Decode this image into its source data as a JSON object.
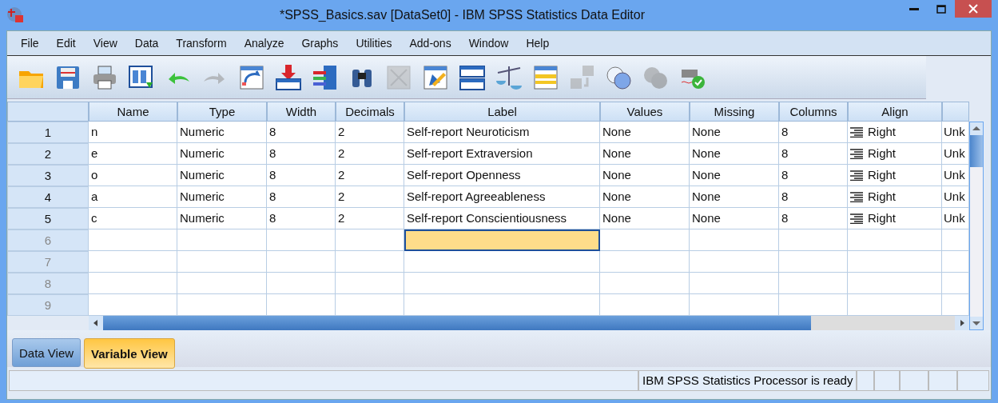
{
  "window": {
    "title": "*SPSS_Basics.sav [DataSet0] - IBM SPSS Statistics Data Editor"
  },
  "menu": [
    "File",
    "Edit",
    "View",
    "Data",
    "Transform",
    "Analyze",
    "Graphs",
    "Utilities",
    "Add-ons",
    "Window",
    "Help"
  ],
  "toolbar": [
    {
      "disabled": false
    },
    {
      "disabled": false
    },
    {
      "disabled": false
    },
    {
      "disabled": false
    },
    {
      "disabled": false
    },
    {
      "disabled": true
    },
    {
      "disabled": false
    },
    {
      "disabled": false
    },
    {
      "disabled": false
    },
    {
      "disabled": false
    },
    {
      "disabled": true
    },
    {
      "disabled": false
    },
    {
      "disabled": false
    },
    {
      "disabled": false
    },
    {
      "disabled": false
    },
    {
      "disabled": true
    },
    {
      "disabled": false
    },
    {
      "disabled": true
    },
    {
      "disabled": false
    }
  ],
  "table": {
    "columns": [
      {
        "label": "Name",
        "kind": "text"
      },
      {
        "label": "Type",
        "kind": "text"
      },
      {
        "label": "Width",
        "kind": "text"
      },
      {
        "label": "Decimals",
        "kind": "text"
      },
      {
        "label": "Label",
        "kind": "text"
      },
      {
        "label": "Values",
        "kind": "text"
      },
      {
        "label": "Missing",
        "kind": "text"
      },
      {
        "label": "Columns",
        "kind": "text"
      },
      {
        "label": "Align",
        "kind": "align"
      },
      {
        "kind": "text"
      }
    ],
    "rows": [
      {
        "number": "1",
        "cells": [
          {
            "text": "n",
            "selected": false
          },
          {
            "text": "Numeric",
            "selected": false
          },
          {
            "text": "8",
            "selected": false
          },
          {
            "text": "2",
            "selected": false
          },
          {
            "text": "Self-report Neuroticism",
            "selected": false
          },
          {
            "text": "None",
            "selected": false
          },
          {
            "text": "None",
            "selected": false
          },
          {
            "text": "8",
            "selected": false
          },
          {
            "text": "Right",
            "selected": false
          },
          {
            "text": "Unk",
            "selected": false
          }
        ]
      },
      {
        "number": "2",
        "cells": [
          {
            "text": "e",
            "selected": false
          },
          {
            "text": "Numeric",
            "selected": false
          },
          {
            "text": "8",
            "selected": false
          },
          {
            "text": "2",
            "selected": false
          },
          {
            "text": "Self-report Extraversion",
            "selected": false
          },
          {
            "text": "None",
            "selected": false
          },
          {
            "text": "None",
            "selected": false
          },
          {
            "text": "8",
            "selected": false
          },
          {
            "text": "Right",
            "selected": false
          },
          {
            "text": "Unk",
            "selected": false
          }
        ]
      },
      {
        "number": "3",
        "cells": [
          {
            "text": "o",
            "selected": false
          },
          {
            "text": "Numeric",
            "selected": false
          },
          {
            "text": "8",
            "selected": false
          },
          {
            "text": "2",
            "selected": false
          },
          {
            "text": "Self-report Openness",
            "selected": false
          },
          {
            "text": "None",
            "selected": false
          },
          {
            "text": "None",
            "selected": false
          },
          {
            "text": "8",
            "selected": false
          },
          {
            "text": "Right",
            "selected": false
          },
          {
            "text": "Unk",
            "selected": false
          }
        ]
      },
      {
        "number": "4",
        "cells": [
          {
            "text": "a",
            "selected": false
          },
          {
            "text": "Numeric",
            "selected": false
          },
          {
            "text": "8",
            "selected": false
          },
          {
            "text": "2",
            "selected": false
          },
          {
            "text": "Self-report Agreeableness",
            "selected": false
          },
          {
            "text": "None",
            "selected": false
          },
          {
            "text": "None",
            "selected": false
          },
          {
            "text": "8",
            "selected": false
          },
          {
            "text": "Right",
            "selected": false
          },
          {
            "text": "Unk",
            "selected": false
          }
        ]
      },
      {
        "number": "5",
        "cells": [
          {
            "text": "c",
            "selected": false
          },
          {
            "text": "Numeric",
            "selected": false
          },
          {
            "text": "8",
            "selected": false
          },
          {
            "text": "2",
            "selected": false
          },
          {
            "text": "Self-report Conscientiousness",
            "selected": false
          },
          {
            "text": "None",
            "selected": false
          },
          {
            "text": "None",
            "selected": false
          },
          {
            "text": "8",
            "selected": false
          },
          {
            "text": "Right",
            "selected": false
          },
          {
            "text": "Unk",
            "selected": false
          }
        ]
      },
      {
        "number": "6",
        "cells": [
          {
            "selected": false
          },
          {
            "selected": false
          },
          {
            "selected": false
          },
          {
            "selected": false
          },
          {
            "selected": true
          },
          {
            "selected": false
          },
          {
            "selected": false
          },
          {
            "selected": false
          },
          {
            "selected": false
          },
          {
            "selected": false
          }
        ]
      },
      {
        "number": "7",
        "cells": [
          {
            "selected": false
          },
          {
            "selected": false
          },
          {
            "selected": false
          },
          {
            "selected": false
          },
          {
            "selected": false
          },
          {
            "selected": false
          },
          {
            "selected": false
          },
          {
            "selected": false
          },
          {
            "selected": false
          },
          {
            "selected": false
          }
        ]
      },
      {
        "number": "8",
        "cells": [
          {
            "selected": false
          },
          {
            "selected": false
          },
          {
            "selected": false
          },
          {
            "selected": false
          },
          {
            "selected": false
          },
          {
            "selected": false
          },
          {
            "selected": false
          },
          {
            "selected": false
          },
          {
            "selected": false
          },
          {
            "selected": false
          }
        ]
      },
      {
        "number": "9",
        "cells": [
          {
            "selected": false
          },
          {
            "selected": false
          },
          {
            "selected": false
          },
          {
            "selected": false
          },
          {
            "selected": false
          },
          {
            "selected": false
          },
          {
            "selected": false
          },
          {
            "selected": false
          },
          {
            "selected": false
          },
          {
            "selected": false
          }
        ]
      }
    ]
  },
  "tabs": [
    {
      "label": "Data View",
      "selected": false
    },
    {
      "label": "Variable View",
      "selected": true
    }
  ],
  "status_bar": {
    "message": "IBM SPSS Statistics Processor is ready"
  }
}
